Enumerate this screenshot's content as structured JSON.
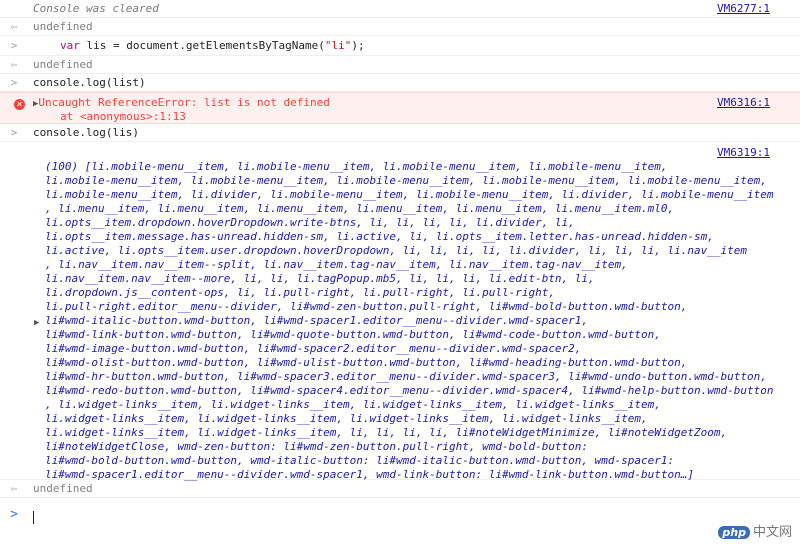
{
  "log": {
    "cleared": "Console was cleared",
    "cleared_src": "VM6277:1",
    "undefined": "undefined",
    "input1_kw": "var",
    "input1_mid": " lis = document.getElementsByTagName(",
    "input1_str": "\"li\"",
    "input1_end": ");",
    "input2": "console.log(list)",
    "error_text": "Uncaught ReferenceError: list is not defined",
    "error_at": "at <anonymous>:1:13",
    "error_src": "VM6316:1",
    "input3": "console.log(lis)",
    "output_src": "VM6319:1"
  },
  "array_lines": [
    "(100) [li.mobile-menu__item, li.mobile-menu__item, li.mobile-menu__item, li.mobile-menu__item,",
    "li.mobile-menu__item, li.mobile-menu__item, li.mobile-menu__item, li.mobile-menu__item, li.mobile-menu__item,",
    "li.mobile-menu__item, li.divider, li.mobile-menu__item, li.mobile-menu__item, li.divider, li.mobile-menu__item",
    ", li.menu__item, li.menu__item, li.menu__item, li.menu__item, li.menu__item, li.menu__item.ml0,",
    "li.opts__item.dropdown.hoverDropdown.write-btns, li, li, li, li, li.divider, li,",
    "li.opts__item.message.has-unread.hidden-sm, li.active, li, li.opts__item.letter.has-unread.hidden-sm,",
    "li.active, li.opts__item.user.dropdown.hoverDropdown, li, li, li, li, li.divider, li, li, li, li.nav__item",
    ", li.nav__item.nav__item--split, li.nav__item.tag-nav__item, li.nav__item.tag-nav__item,",
    "li.nav__item.nav__item--more, li, li, li.tagPopup.mb5, li, li, li, li.edit-btn, li,",
    "li.dropdown.js__content-ops, li, li.pull-right, li.pull-right, li.pull-right,",
    "li.pull-right.editor__menu--divider, li#wmd-zen-button.pull-right, li#wmd-bold-button.wmd-button,",
    "li#wmd-italic-button.wmd-button, li#wmd-spacer1.editor__menu--divider.wmd-spacer1,",
    "li#wmd-link-button.wmd-button, li#wmd-quote-button.wmd-button, li#wmd-code-button.wmd-button,",
    "li#wmd-image-button.wmd-button, li#wmd-spacer2.editor__menu--divider.wmd-spacer2,",
    "li#wmd-olist-button.wmd-button, li#wmd-ulist-button.wmd-button, li#wmd-heading-button.wmd-button,",
    "li#wmd-hr-button.wmd-button, li#wmd-spacer3.editor__menu--divider.wmd-spacer3, li#wmd-undo-button.wmd-button,",
    "li#wmd-redo-button.wmd-button, li#wmd-spacer4.editor__menu--divider.wmd-spacer4, li#wmd-help-button.wmd-button",
    ", li.widget-links__item, li.widget-links__item, li.widget-links__item, li.widget-links__item,",
    "li.widget-links__item, li.widget-links__item, li.widget-links__item, li.widget-links__item,",
    "li.widget-links__item, li.widget-links__item, li, li, li, li, li#noteWidgetMinimize, li#noteWidgetZoom,",
    "li#noteWidgetClose, wmd-zen-button: li#wmd-zen-button.pull-right, wmd-bold-button:",
    "li#wmd-bold-button.wmd-button, wmd-italic-button: li#wmd-italic-button.wmd-button, wmd-spacer1:",
    "li#wmd-spacer1.editor__menu--divider.wmd-spacer1, wmd-link-button: li#wmd-link-button.wmd-button…]"
  ],
  "watermark": {
    "logo": "php",
    "text": "中文网"
  }
}
